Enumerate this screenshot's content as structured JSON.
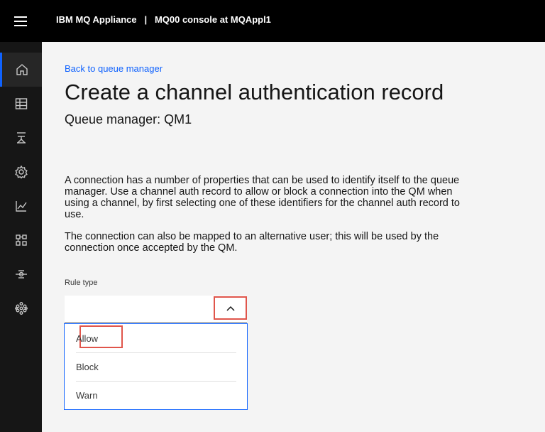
{
  "header": {
    "title": "IBM MQ Appliance   |   MQ00 console at MQAppl1"
  },
  "sidebar": {
    "items": [
      {
        "icon": "home-icon",
        "active": true
      },
      {
        "icon": "table-icon",
        "active": false
      },
      {
        "icon": "network-icon",
        "active": false
      },
      {
        "icon": "gear-icon",
        "active": false
      },
      {
        "icon": "chart-icon",
        "active": false
      },
      {
        "icon": "apps-icon",
        "active": false
      },
      {
        "icon": "sliders-icon",
        "active": false
      },
      {
        "icon": "grid-dots-icon",
        "active": false
      }
    ]
  },
  "main": {
    "back_link": "Back to queue manager",
    "title": "Create a channel authentication record",
    "queue_manager": "Queue manager: QM1",
    "description_1": "A connection has a number of properties that can be used to identify itself to the queue manager. Use a channel auth record to allow or block a connection into the QM when using a channel, by first selecting one of these identifiers for the channel auth record to use.",
    "description_2": "The connection can also be mapped to an alternative user; this will be used by the connection once accepted by the QM.",
    "rule_type": {
      "label": "Rule type",
      "value": "",
      "options": [
        "Allow",
        "Block",
        "Warn"
      ]
    }
  },
  "colors": {
    "accent": "#0f62fe",
    "highlight": "#e0554b",
    "header_bg": "#000000",
    "sidebar_bg": "#161616"
  }
}
